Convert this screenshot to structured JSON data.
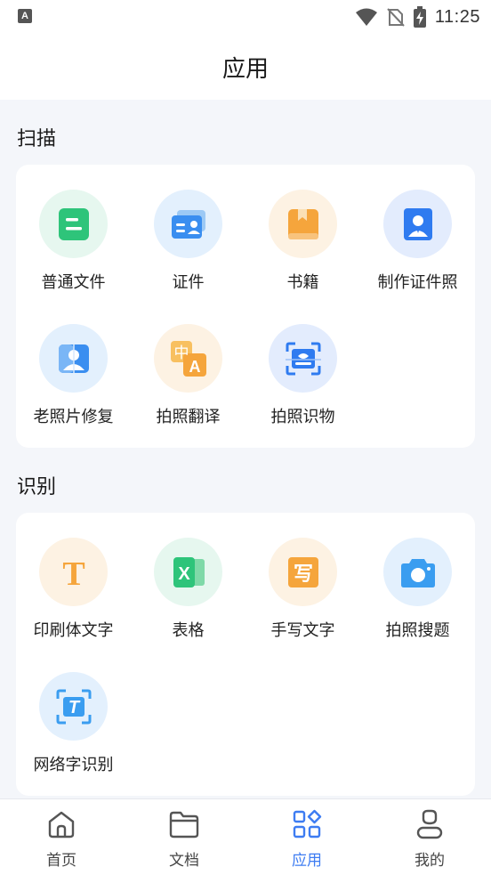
{
  "status_bar": {
    "time": "11:25",
    "app_icon_letter": "A"
  },
  "header": {
    "title": "应用"
  },
  "sections": [
    {
      "title": "扫描",
      "items": [
        {
          "label": "普通文件",
          "icon": "document-icon"
        },
        {
          "label": "证件",
          "icon": "id-card-icon"
        },
        {
          "label": "书籍",
          "icon": "book-icon"
        },
        {
          "label": "制作证件照",
          "icon": "id-photo-icon"
        },
        {
          "label": "老照片修复",
          "icon": "photo-restore-icon"
        },
        {
          "label": "拍照翻译",
          "icon": "translate-icon"
        },
        {
          "label": "拍照识物",
          "icon": "object-recognize-icon"
        }
      ]
    },
    {
      "title": "识别",
      "items": [
        {
          "label": "印刷体文字",
          "icon": "printed-text-icon"
        },
        {
          "label": "表格",
          "icon": "excel-icon"
        },
        {
          "label": "手写文字",
          "icon": "handwriting-icon"
        },
        {
          "label": "拍照搜题",
          "icon": "camera-icon"
        },
        {
          "label": "网络字识别",
          "icon": "web-text-icon"
        }
      ]
    }
  ],
  "icons": {
    "translate_glyph_1": "中",
    "translate_glyph_2": "A",
    "printed_glyph": "T",
    "excel_glyph": "X",
    "handwriting_glyph": "写",
    "web_text_glyph": "T"
  },
  "tabs": [
    {
      "label": "首页",
      "icon": "home-icon",
      "active": false
    },
    {
      "label": "文档",
      "icon": "folder-icon",
      "active": false
    },
    {
      "label": "应用",
      "icon": "apps-icon",
      "active": true
    },
    {
      "label": "我的",
      "icon": "user-icon",
      "active": false
    }
  ],
  "colors": {
    "accent": "#3d7cf2",
    "green": "#2ec47a",
    "blue": "#3a8ef0",
    "orange": "#f5a53c"
  }
}
